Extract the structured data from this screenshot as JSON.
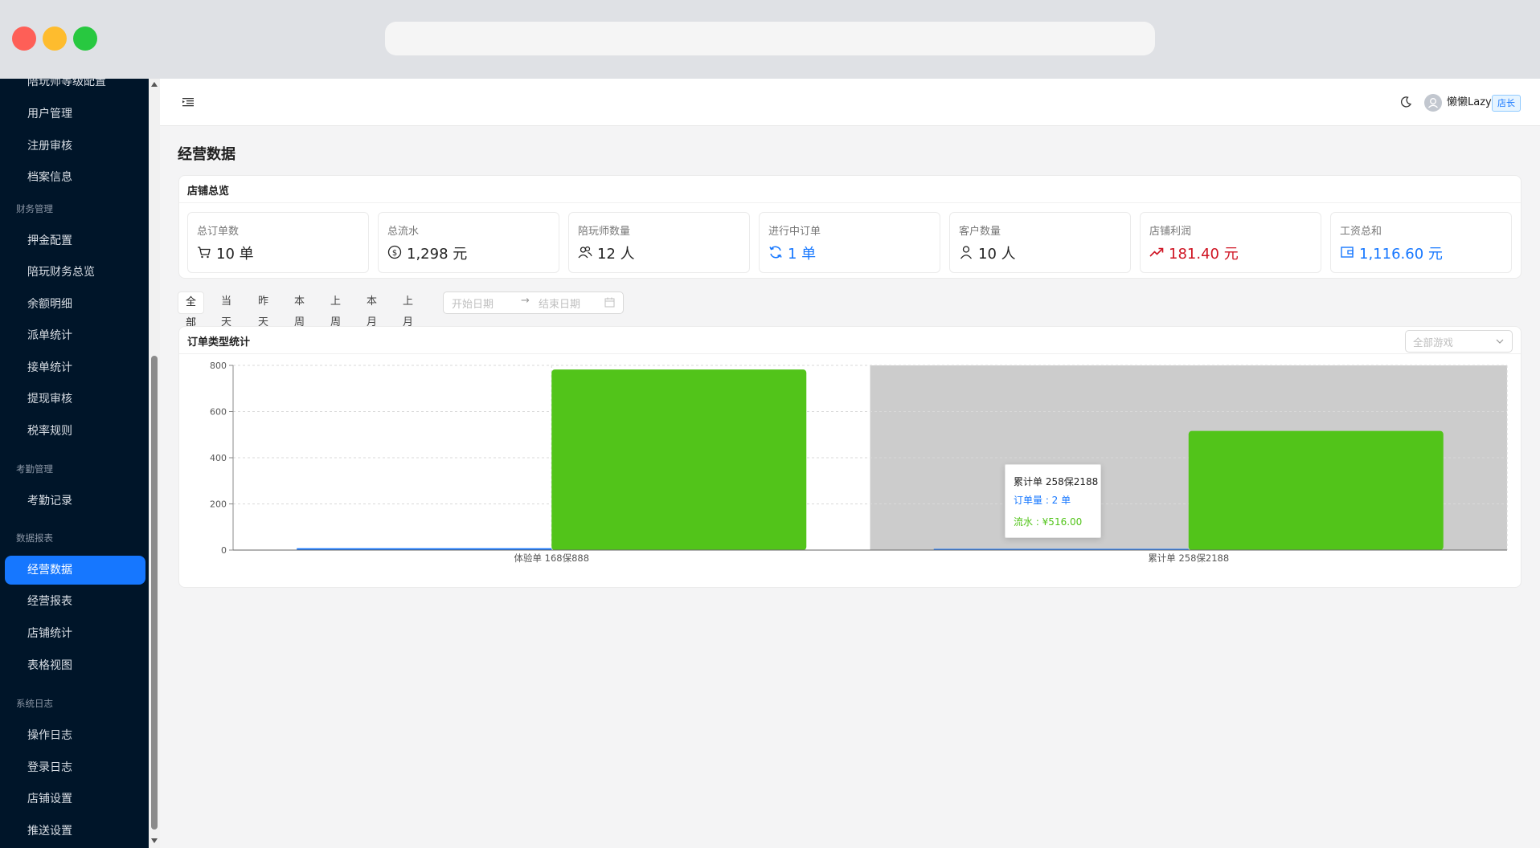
{
  "sidebar": {
    "items": [
      {
        "label": "陪玩师等级配置",
        "top": -6
      },
      {
        "label": "用户管理"
      },
      {
        "label": "注册审核"
      },
      {
        "label": "档案信息"
      }
    ],
    "groups": {
      "finance": "财务管理",
      "attendance": "考勤管理",
      "reports": "数据报表",
      "logs": "系统日志"
    },
    "finance_items": [
      "押金配置",
      "陪玩财务总览",
      "余额明细",
      "派单统计",
      "接单统计",
      "提现审核",
      "税率规则"
    ],
    "attendance_items": [
      "考勤记录"
    ],
    "report_items": [
      "经营数据",
      "经营报表",
      "店铺统计",
      "表格视图"
    ],
    "log_items": [
      "操作日志",
      "登录日志",
      "店铺设置",
      "推送设置"
    ]
  },
  "header": {
    "username": "懒懒Lazy",
    "role": "店长"
  },
  "page": {
    "title": "经营数据"
  },
  "overview": {
    "title": "店铺总览",
    "stats": [
      {
        "label": "总订单数",
        "value": "10 单",
        "icon": "cart-icon",
        "color": "#222222"
      },
      {
        "label": "总流水",
        "value": "1,298 元",
        "icon": "dollar-icon",
        "color": "#222222"
      },
      {
        "label": "陪玩师数量",
        "value": "12 人",
        "icon": "team-icon",
        "color": "#222222"
      },
      {
        "label": "进行中订单",
        "value": "1 单",
        "icon": "sync-icon",
        "color": "#1677ff"
      },
      {
        "label": "客户数量",
        "value": "10 人",
        "icon": "user-icon",
        "color": "#222222"
      },
      {
        "label": "店铺利润",
        "value": "181.40 元",
        "icon": "rise-icon",
        "color": "#cf1322"
      },
      {
        "label": "工资总和",
        "value": "1,116.60 元",
        "icon": "wallet-icon",
        "color": "#1677ff"
      }
    ]
  },
  "filters": {
    "periods": [
      "全部",
      "当天",
      "昨天",
      "本周",
      "上周",
      "本月",
      "上月"
    ],
    "active": "全部",
    "start_placeholder": "开始日期",
    "arrow": "→",
    "end_placeholder": "结束日期"
  },
  "order_stats": {
    "title": "订单类型统计",
    "game_select_placeholder": "全部游戏"
  },
  "colors": {
    "accent": "#1677ff",
    "bar_green": "#52c41a",
    "sidebar_bg": "#001529"
  },
  "chart_data": {
    "type": "bar",
    "categories": [
      "体验单 168保888",
      "累计单 258保2188"
    ],
    "series": [
      {
        "name": "订单量",
        "values": [
          8,
          2
        ],
        "color": "#1677ff"
      },
      {
        "name": "流水",
        "values": [
          782,
          516
        ],
        "color": "#52c41a"
      }
    ],
    "yticks": [
      0,
      200,
      400,
      600,
      800
    ],
    "ylim": [
      0,
      800
    ],
    "grid": true,
    "hovered_category": "累计单 258保2188",
    "tooltip": {
      "title": "累计单 258保2188",
      "line1": "订单量 : 2 单",
      "line2": "流水 : ¥516.00"
    }
  }
}
